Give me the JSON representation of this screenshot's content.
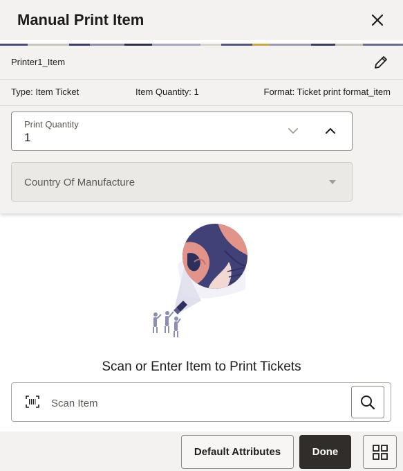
{
  "dialog": {
    "title": "Manual Print Item",
    "close_icon": "close-icon"
  },
  "item": {
    "name": "Printer1_Item",
    "edit_icon": "pencil-icon",
    "type": "Type: Item Ticket",
    "quantity": "Item Quantity: 1",
    "format": "Format: Ticket print format_item"
  },
  "print_quantity": {
    "label": "Print Quantity",
    "value": "1",
    "decrement_icon": "chevron-down-icon",
    "increment_icon": "chevron-up-icon"
  },
  "country_of_manufacture": {
    "label": "Country Of Manufacture",
    "caret_icon": "caret-down-icon"
  },
  "empty_state": {
    "prompt": "Scan or Enter Item to Print Tickets"
  },
  "scan": {
    "placeholder": "Scan Item",
    "barcode_icon": "barcode-icon",
    "search_icon": "search-icon"
  },
  "footer": {
    "default_attributes_label": "Default Attributes",
    "done_label": "Done",
    "grid_icon": "grid-icon"
  },
  "colors": {
    "header_bg": "#f3f2f0",
    "primary_button": "#312d2a",
    "illustration_navy": "#3f4177",
    "illustration_coral": "#e3948a"
  }
}
